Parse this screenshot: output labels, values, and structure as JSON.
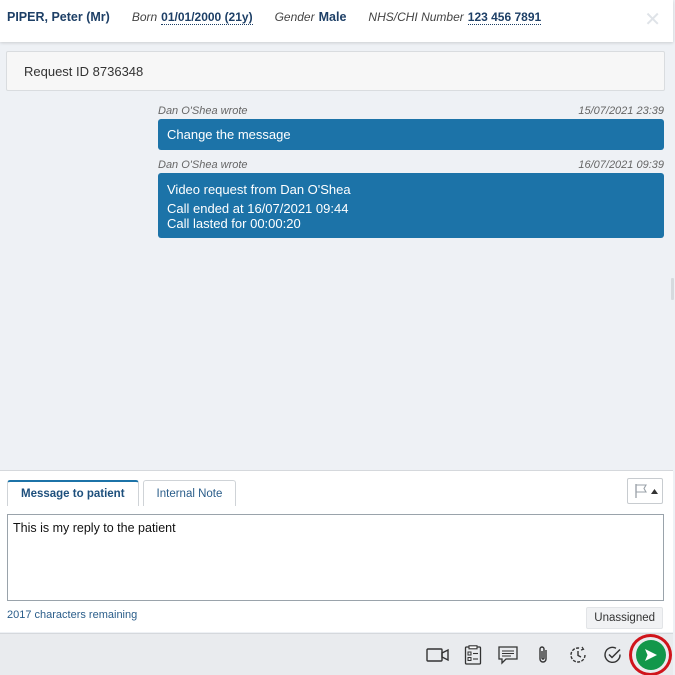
{
  "patient": {
    "name": "PIPER, Peter (Mr)",
    "born_label": "Born",
    "born_value": "01/01/2000 (21y)",
    "gender_label": "Gender",
    "gender_value": "Male",
    "nhs_label": "NHS/CHI Number",
    "nhs_value": "123 456 7891"
  },
  "request": {
    "label": "Request ID 8736348"
  },
  "messages": [
    {
      "author": "Dan O'Shea wrote",
      "timestamp": "15/07/2021 23:39",
      "lines": [
        "Change the message"
      ]
    },
    {
      "author": "Dan O'Shea wrote",
      "timestamp": "16/07/2021 09:39",
      "lines": [
        "Video request from Dan O'Shea",
        "Call ended at 16/07/2021 09:44",
        "Call lasted for 00:00:20"
      ]
    }
  ],
  "compose": {
    "tabs": [
      {
        "label": "Message to patient",
        "active": true
      },
      {
        "label": "Internal Note",
        "active": false
      }
    ],
    "reply_value": "This is my reply to the patient",
    "chars_remaining": "2017 characters remaining",
    "assignee": "Unassigned"
  },
  "toolbar": {
    "icons": [
      "video-call-icon",
      "form-icon",
      "message-template-icon",
      "attachment-icon",
      "snooze-icon",
      "complete-icon",
      "send-icon"
    ]
  },
  "colors": {
    "accent": "#1c73a8",
    "send": "#12974a",
    "highlight": "#d0141b"
  }
}
